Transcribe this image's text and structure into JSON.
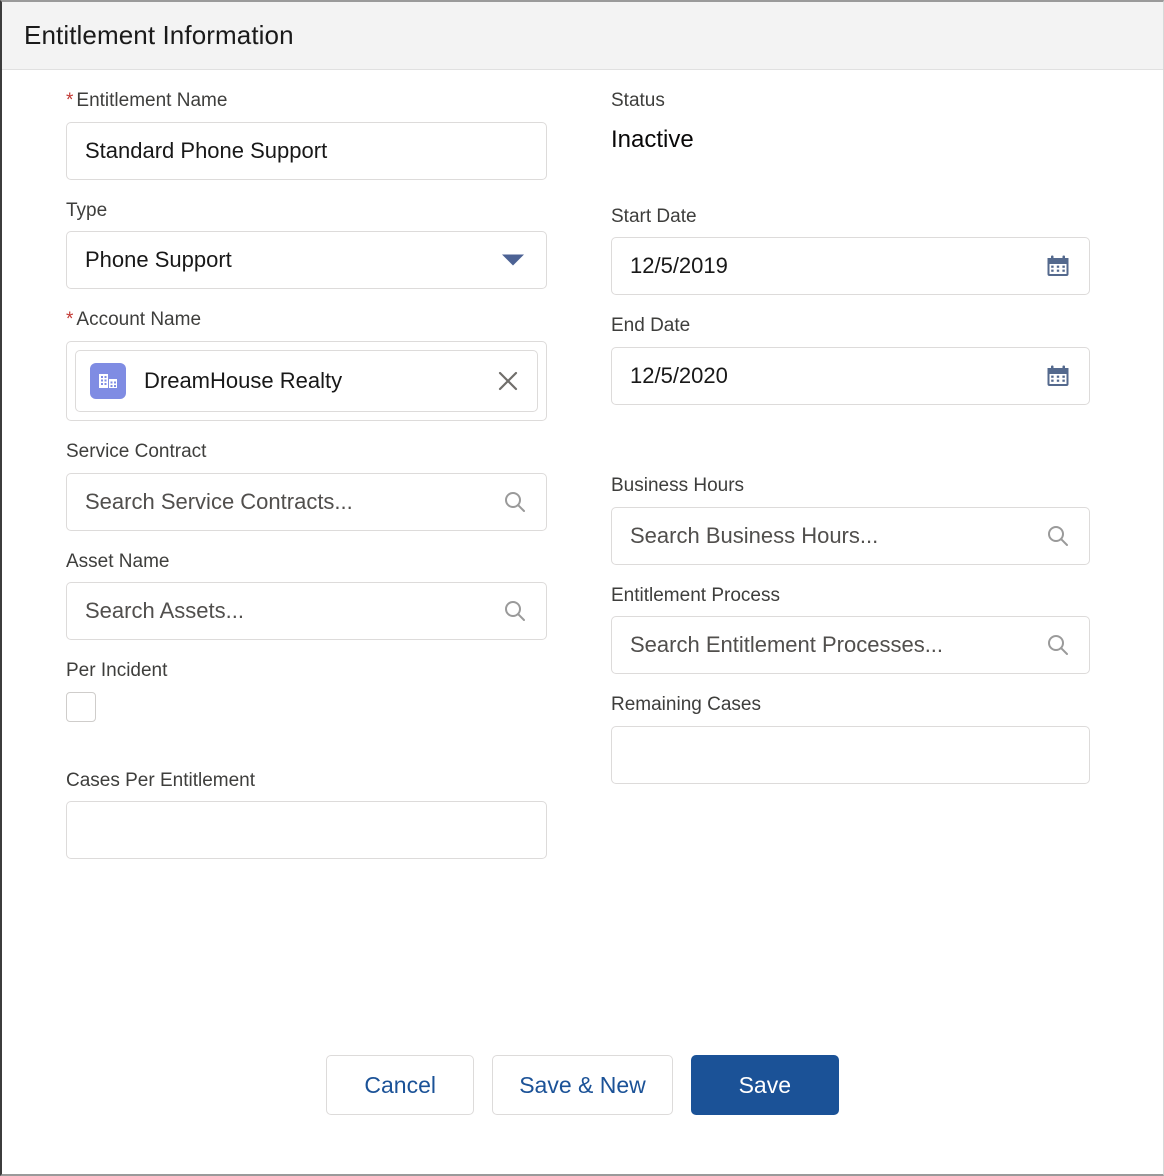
{
  "section": {
    "title": "Entitlement Information"
  },
  "fields": {
    "entitlement_name": {
      "label": "Entitlement Name",
      "required": true,
      "value": "Standard Phone Support"
    },
    "status": {
      "label": "Status",
      "value": "Inactive"
    },
    "type": {
      "label": "Type",
      "required": false,
      "value": "Phone Support",
      "icon": "chevron-down-icon"
    },
    "start_date": {
      "label": "Start Date",
      "value": "12/5/2019",
      "icon": "calendar-icon"
    },
    "account_name": {
      "label": "Account Name",
      "required": true,
      "value": "DreamHouse Realty",
      "icon": "account-building-icon",
      "icon_color": "#7f8ce3",
      "remove_icon": "close-icon"
    },
    "end_date": {
      "label": "End Date",
      "value": "12/5/2020",
      "icon": "calendar-icon"
    },
    "service_contract": {
      "label": "Service Contract",
      "placeholder": "Search Service Contracts...",
      "value": "",
      "icon": "search-icon"
    },
    "business_hours": {
      "label": "Business Hours",
      "placeholder": "Search Business Hours...",
      "value": "",
      "icon": "search-icon"
    },
    "asset_name": {
      "label": "Asset Name",
      "placeholder": "Search Assets...",
      "value": "",
      "icon": "search-icon"
    },
    "entitlement_process": {
      "label": "Entitlement Process",
      "placeholder": "Search Entitlement Processes...",
      "value": "",
      "icon": "search-icon"
    },
    "per_incident": {
      "label": "Per Incident",
      "checked": false
    },
    "remaining_cases": {
      "label": "Remaining Cases",
      "value": ""
    },
    "cases_per_entitlement": {
      "label": "Cases Per Entitlement",
      "value": ""
    }
  },
  "footer": {
    "cancel_label": "Cancel",
    "save_new_label": "Save & New",
    "save_label": "Save"
  },
  "colors": {
    "brand": "#1b5297",
    "link": "#1b5297",
    "required_asterisk": "#c23934",
    "header_bg": "#f3f3f3",
    "border": "#dddbda",
    "label_text": "#3e3e3c",
    "value_text": "#181818",
    "calendar_icon": "#54698d",
    "search_icon": "#9a9a9a"
  }
}
